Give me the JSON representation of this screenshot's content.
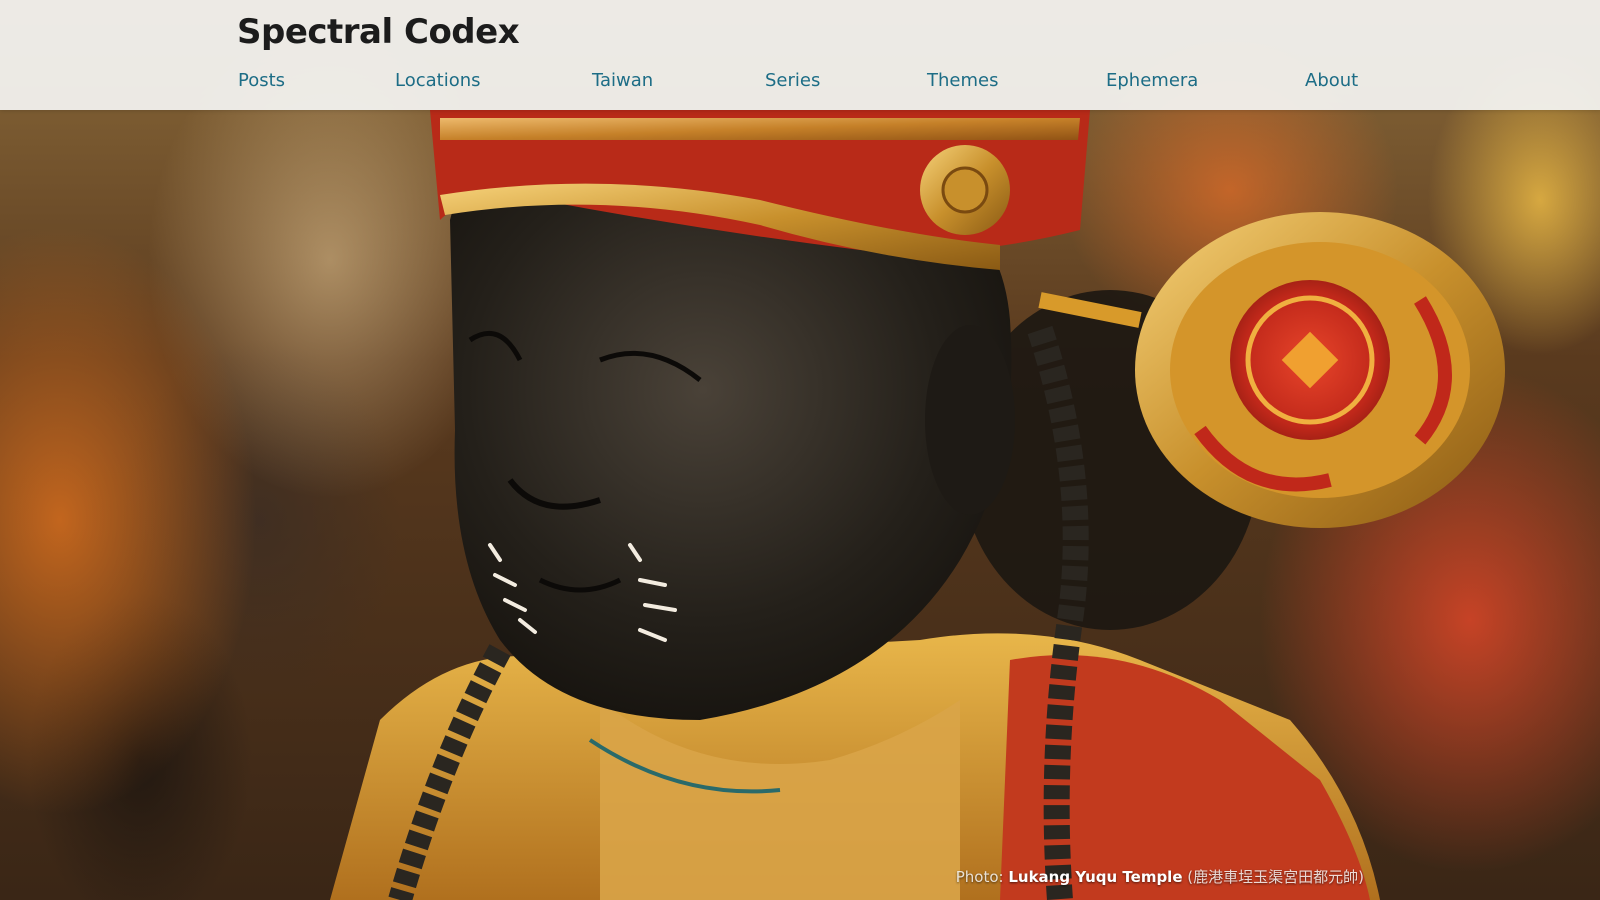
{
  "site": {
    "title": "Spectral Codex"
  },
  "nav": {
    "items": [
      {
        "label": "Posts"
      },
      {
        "label": "Locations"
      },
      {
        "label": "Taiwan"
      },
      {
        "label": "Series"
      },
      {
        "label": "Themes"
      },
      {
        "label": "Ephemera"
      },
      {
        "label": "About"
      }
    ]
  },
  "hero": {
    "caption_prefix": "Photo:",
    "caption_title": "Lukang Yuqu Temple",
    "caption_suffix": "(鹿港車埕玉渠宮田都元帥)"
  },
  "colors": {
    "header_bg": "#f4f4f2",
    "nav_link": "#1d6d86",
    "title_text": "#1c1c1c"
  }
}
